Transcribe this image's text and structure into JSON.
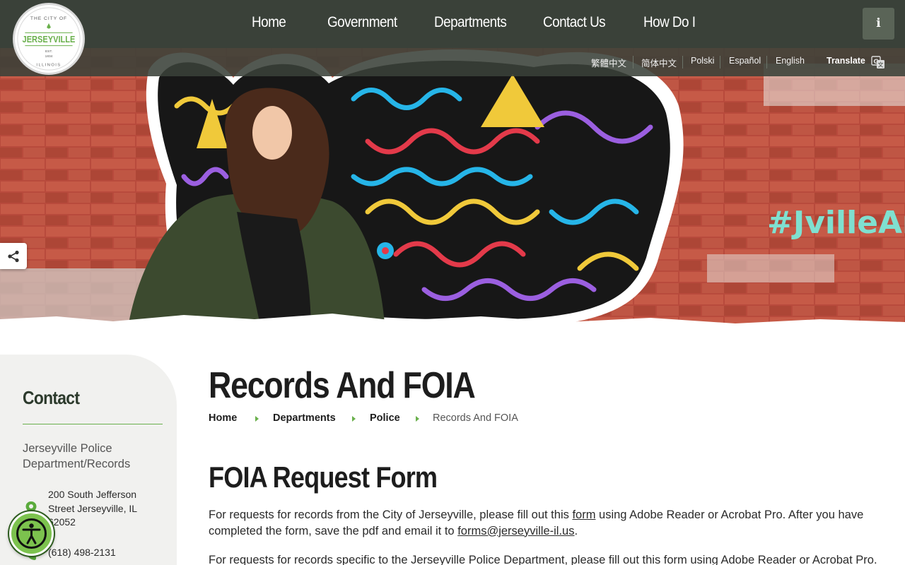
{
  "nav": {
    "items": [
      "Home",
      "Government",
      "Departments",
      "Contact Us",
      "How Do I"
    ],
    "info_label": "i"
  },
  "languages": [
    "繁體中文",
    "简体中文",
    "Polski",
    "Español",
    "English"
  ],
  "translate_label": "Translate",
  "logo": {
    "top": "THE CITY OF",
    "name": "JERSEYVILLE",
    "est": "EST.",
    "year": "1834",
    "state": "ILLINOIS"
  },
  "hero": {
    "mural_text": "#JvilleAr"
  },
  "sidebar": {
    "title": "Contact",
    "department": "Jerseyville Police Department/Records",
    "address": "200 South Jefferson Street Jerseyville, IL 62052",
    "phone": "(618) 498-2131"
  },
  "page": {
    "title": "Records And FOIA",
    "breadcrumbs": [
      "Home",
      "Departments",
      "Police",
      "Records And FOIA"
    ],
    "section_title": "FOIA Request Form",
    "para1": {
      "before": "For requests for records from the City of Jerseyville, please fill out this ",
      "link": "form",
      "middle": " using Adobe Reader or Acrobat Pro. After you have completed the form, save the pdf and email it to ",
      "email": "forms@jerseyville-il.us",
      "after": "."
    },
    "para2": "For requests for records specific to the Jerseyville Police Department, please fill out this form using Adobe Reader or Acrobat Pro."
  },
  "colors": {
    "header_bg": "#3a4139",
    "accent_green": "#6ab04c",
    "sidebar_bg": "#f1f1ef",
    "accessibility_green": "#7cc24e"
  }
}
